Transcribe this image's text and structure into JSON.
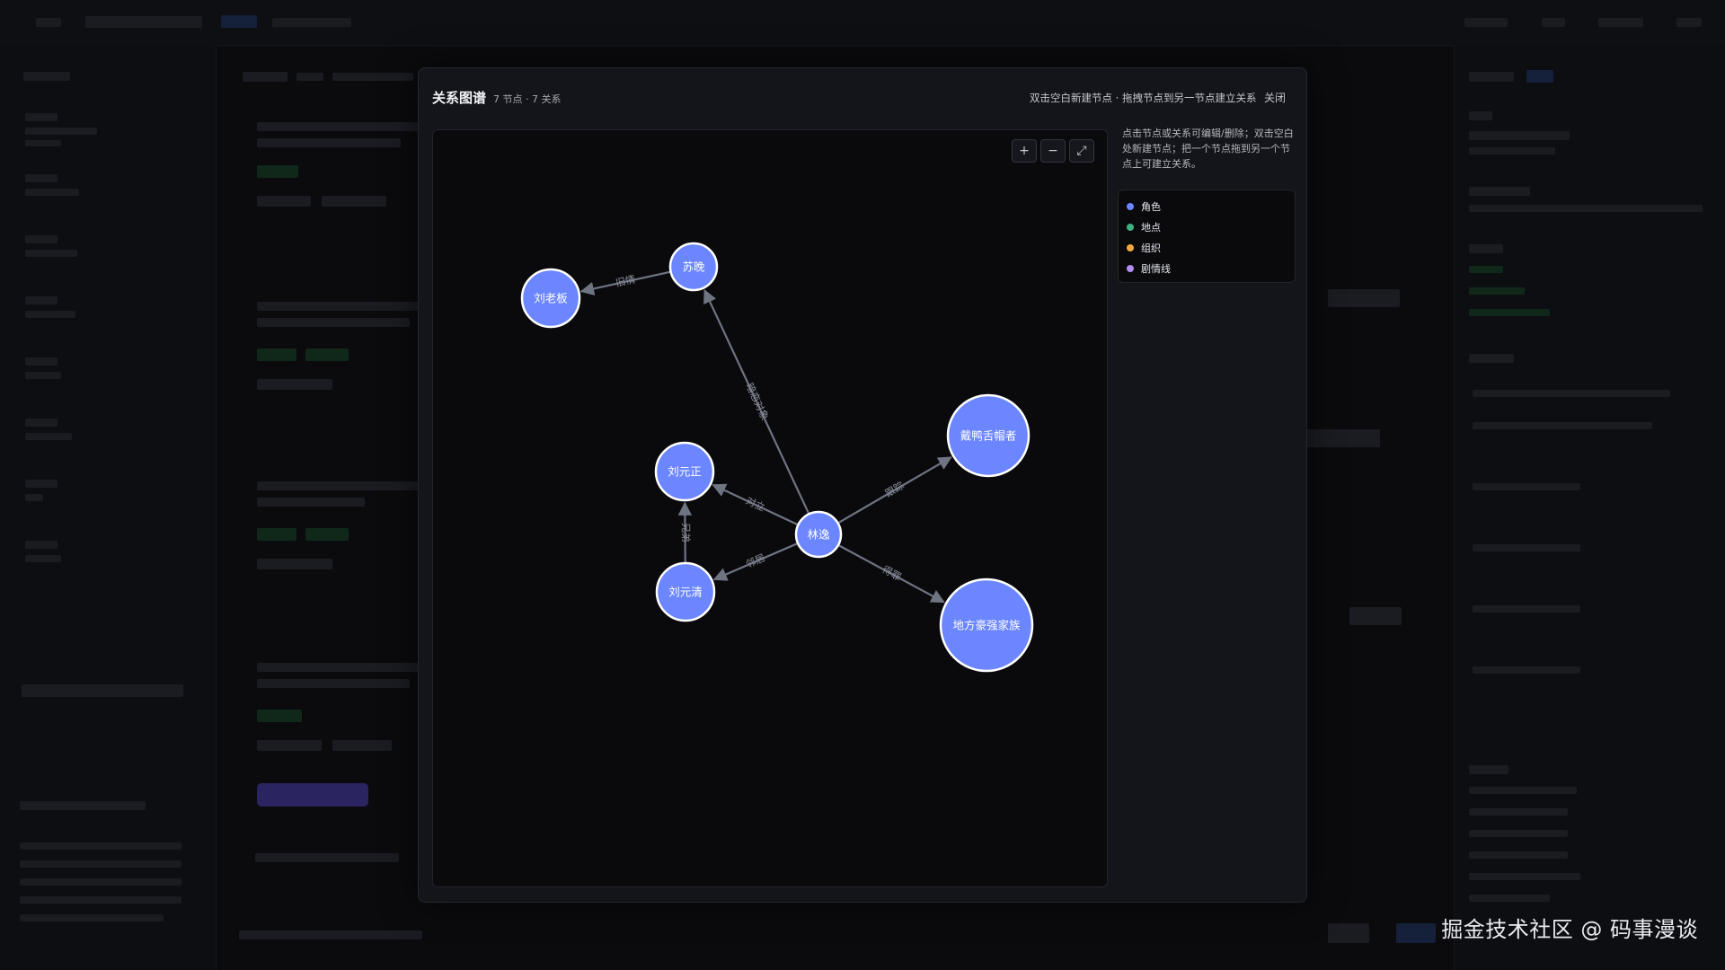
{
  "modal": {
    "title": "关系图谱",
    "stats": "7 节点 · 7 关系",
    "hint": "双击空白新建节点 · 拖拽节点到另一节点建立关系",
    "close_label": "关闭",
    "info": "点击节点或关系可编辑/删除；双击空白处新建节点；把一个节点拖到另一个节点上可建立关系。",
    "zoom_in": "+",
    "zoom_out": "−",
    "fit": "⤢"
  },
  "legend": [
    {
      "label": "角色",
      "color": "#6b86ff"
    },
    {
      "label": "地点",
      "color": "#3fb27f"
    },
    {
      "label": "组织",
      "color": "#f0a940"
    },
    {
      "label": "剧情线",
      "color": "#b38cf0"
    }
  ],
  "colors": {
    "node_fill": "#6b86ff",
    "node_stroke": "#ffffff",
    "edge": "#6f7482",
    "edge_label": "#8b8f9b"
  },
  "graph": {
    "nodes": [
      {
        "id": "linyi",
        "label": "林逸"
      },
      {
        "id": "suwan",
        "label": "苏晚"
      },
      {
        "id": "liulaoban",
        "label": "刘老板"
      },
      {
        "id": "liuyuanzheng",
        "label": "刘元正"
      },
      {
        "id": "liuyuanqing",
        "label": "刘元清"
      },
      {
        "id": "daiyashe",
        "label": "戴鸭舌帽者"
      },
      {
        "id": "difang",
        "label": "地方豪强家族"
      }
    ],
    "edges": [
      {
        "from": "suwan",
        "to": "liulaoban",
        "label": "旧情"
      },
      {
        "from": "linyi",
        "to": "suwan",
        "label": "暗恋对象"
      },
      {
        "from": "linyi",
        "to": "daiyashe",
        "label": "跟踪"
      },
      {
        "from": "linyi",
        "to": "liuyuanzheng",
        "label": "对立"
      },
      {
        "from": "linyi",
        "to": "liuyuanqing",
        "label": "邻居"
      },
      {
        "from": "liuyuanqing",
        "to": "liuyuanzheng",
        "label": "兄弟"
      },
      {
        "from": "linyi",
        "to": "difang",
        "label": "得罪"
      }
    ]
  },
  "watermark": "掘金技术社区 @ 码事漫谈"
}
